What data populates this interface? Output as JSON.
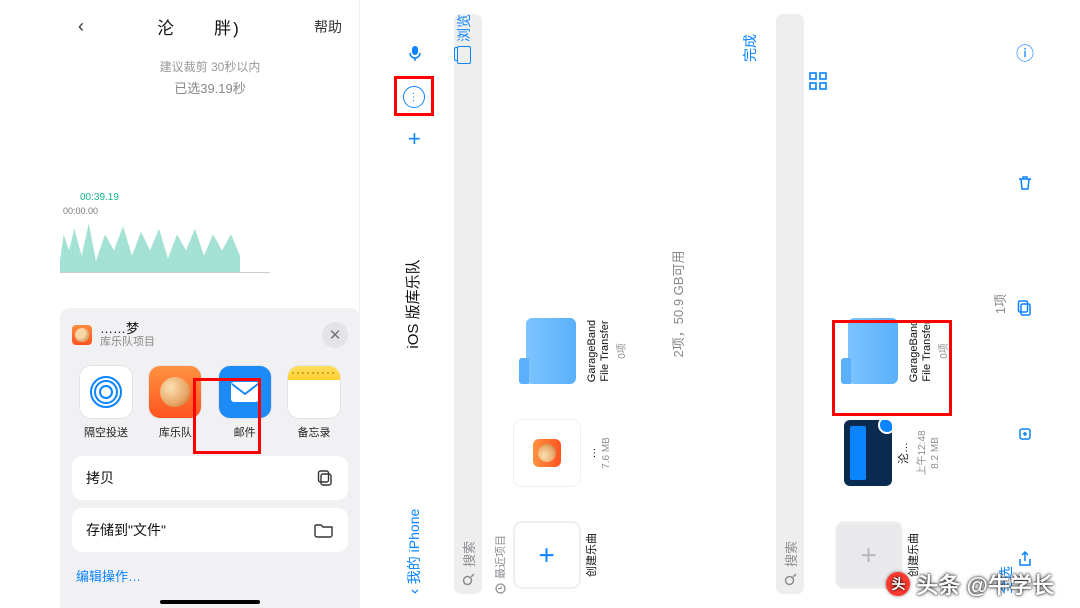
{
  "panel1": {
    "header": {
      "back": "‹",
      "title": "沦　　胖)",
      "help": "帮助"
    },
    "hint": "建议裁剪 30秒以内",
    "selected": "已选39.19秒",
    "wave": {
      "head": "00:39.19",
      "start": "00:00.00"
    },
    "sheet": {
      "title": "……梦",
      "subtitle": "库乐队项目",
      "close": "✕",
      "apps": [
        {
          "name": "airdrop",
          "label": "隔空投送"
        },
        {
          "name": "garageband",
          "label": "库乐队"
        },
        {
          "name": "mail",
          "label": "邮件"
        },
        {
          "name": "notes",
          "label": "备忘录"
        }
      ],
      "actions": {
        "copy": "拷贝",
        "save_files": "存储到\"文件\"",
        "edit": "编辑操作…"
      }
    }
  },
  "panel2a": {
    "back": "我的 iPhone",
    "title": "iOS 版库乐队"
  },
  "panel2b": {
    "search": "搜索",
    "recent_header": "最近项目",
    "create": "创建乐曲",
    "doc_name": "…",
    "doc_meta": "7.6 MB",
    "folder_name": "GarageBand File Transfer",
    "folder_meta": "0项",
    "status": "2项，50.9 GB可用",
    "browse": "浏览"
  },
  "panel3": {
    "select_all": "全选",
    "done": "完成",
    "search": "搜索",
    "count": "1项",
    "create": "创建乐曲",
    "proj_name": "沦…",
    "proj_time": "上午12:48",
    "proj_size": "8.2 MB",
    "folder_name": "GarageBand File Transfer",
    "folder_meta": "0项"
  },
  "watermark": "头条 @牛学长"
}
